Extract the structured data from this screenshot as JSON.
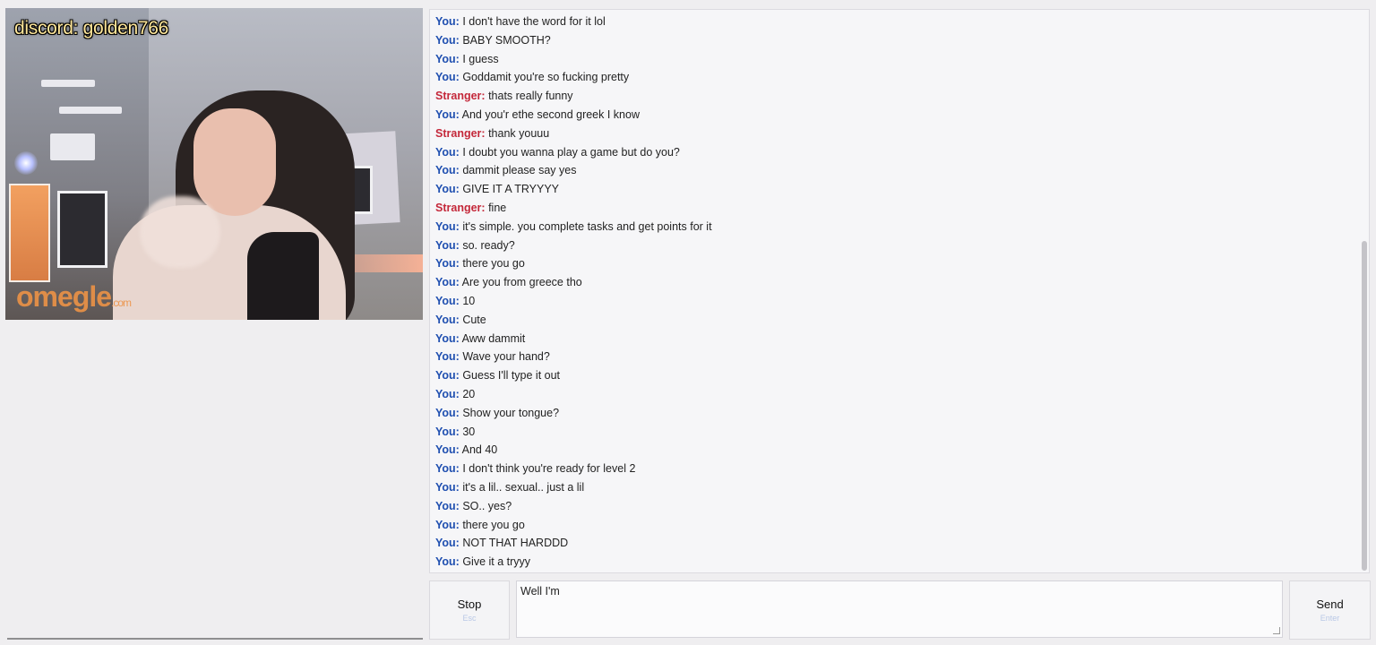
{
  "video": {
    "overlay_text": "discord: golden766",
    "watermark": "omegle",
    "watermark_suffix": ".com"
  },
  "chat": {
    "messages": [
      {
        "sender": "You:",
        "role": "you",
        "text": "I don't have the word for it lol"
      },
      {
        "sender": "You:",
        "role": "you",
        "text": "BABY SMOOTH?"
      },
      {
        "sender": "You:",
        "role": "you",
        "text": "I guess"
      },
      {
        "sender": "You:",
        "role": "you",
        "text": "Goddamit you're so fucking pretty"
      },
      {
        "sender": "Stranger:",
        "role": "stranger",
        "text": "thats really funny"
      },
      {
        "sender": "You:",
        "role": "you",
        "text": "And you'r ethe second greek I know"
      },
      {
        "sender": "Stranger:",
        "role": "stranger",
        "text": "thank youuu"
      },
      {
        "sender": "You:",
        "role": "you",
        "text": "I doubt you wanna play a game but do you?"
      },
      {
        "sender": "You:",
        "role": "you",
        "text": "dammit please say yes"
      },
      {
        "sender": "You:",
        "role": "you",
        "text": "GIVE IT A TRYYYY"
      },
      {
        "sender": "Stranger:",
        "role": "stranger",
        "text": "fine"
      },
      {
        "sender": "You:",
        "role": "you",
        "text": "it's simple. you complete tasks and get points for it"
      },
      {
        "sender": "You:",
        "role": "you",
        "text": "so. ready?"
      },
      {
        "sender": "You:",
        "role": "you",
        "text": "there you go"
      },
      {
        "sender": "You:",
        "role": "you",
        "text": "Are you from greece tho"
      },
      {
        "sender": "You:",
        "role": "you",
        "text": "10"
      },
      {
        "sender": "You:",
        "role": "you",
        "text": "Cute"
      },
      {
        "sender": "You:",
        "role": "you",
        "text": "Aww dammit"
      },
      {
        "sender": "You:",
        "role": "you",
        "text": "Wave your hand?"
      },
      {
        "sender": "You:",
        "role": "you",
        "text": "Guess I'll type it out"
      },
      {
        "sender": "You:",
        "role": "you",
        "text": "20"
      },
      {
        "sender": "You:",
        "role": "you",
        "text": "Show your tongue?"
      },
      {
        "sender": "You:",
        "role": "you",
        "text": "30"
      },
      {
        "sender": "You:",
        "role": "you",
        "text": "And 40"
      },
      {
        "sender": "You:",
        "role": "you",
        "text": "I don't think you're ready for level 2"
      },
      {
        "sender": "You:",
        "role": "you",
        "text": "it's a lil.. sexual.. just a lil"
      },
      {
        "sender": "You:",
        "role": "you",
        "text": "SO.. yes?"
      },
      {
        "sender": "You:",
        "role": "you",
        "text": "there you go"
      },
      {
        "sender": "You:",
        "role": "you",
        "text": "NOT THAT HARDDD"
      },
      {
        "sender": "You:",
        "role": "you",
        "text": "Give it a tryyy"
      }
    ]
  },
  "controls": {
    "stop_label": "Stop",
    "stop_hint": "Esc",
    "send_label": "Send",
    "send_hint": "Enter",
    "input_value": "Well I'm"
  },
  "colors": {
    "you": "#1f4fb0",
    "stranger": "#c4283a",
    "background": "#efeef0"
  }
}
